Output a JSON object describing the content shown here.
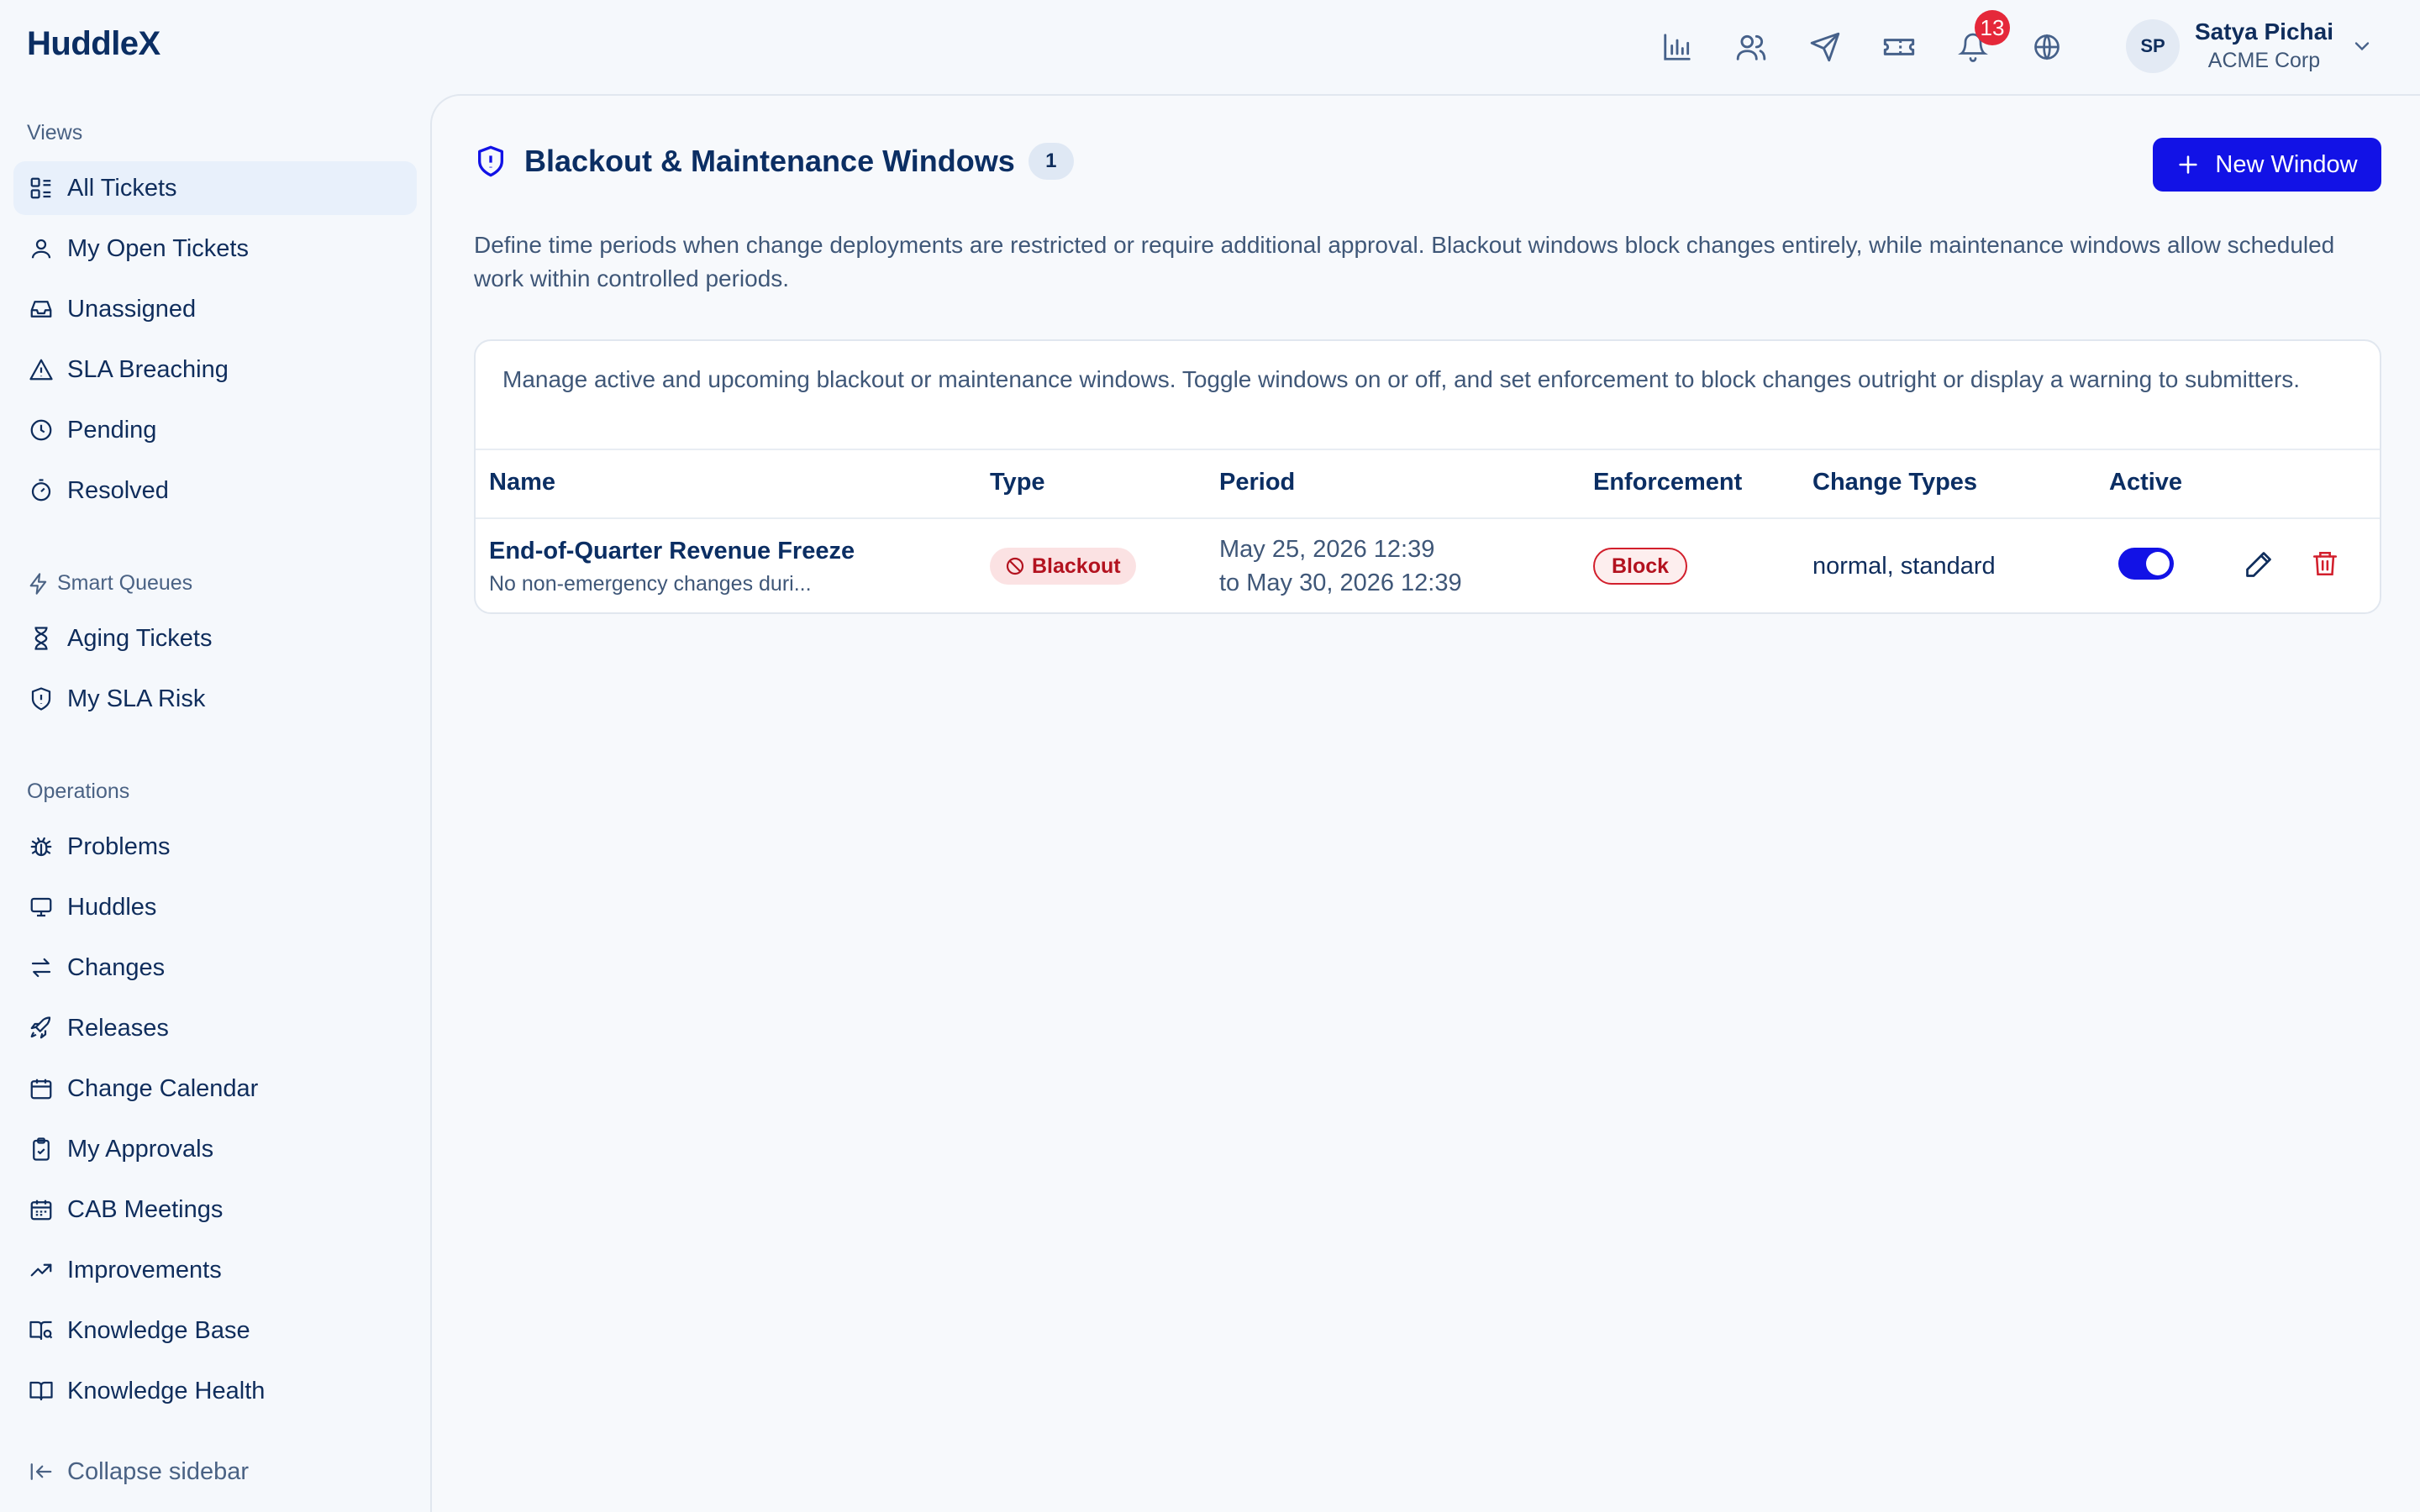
{
  "app": {
    "name": "HuddleX"
  },
  "topbar": {
    "icons": [
      "bar-chart-icon",
      "users-icon",
      "send-icon",
      "ticket-icon",
      "bell-icon",
      "globe-icon"
    ],
    "notification_count": "13",
    "user": {
      "initials": "SP",
      "name": "Satya Pichai",
      "org": "ACME Corp"
    }
  },
  "sidebar": {
    "views_label": "Views",
    "views": [
      {
        "label": "All Tickets",
        "icon": "list-icon",
        "active": true
      },
      {
        "label": "My Open Tickets",
        "icon": "user-icon"
      },
      {
        "label": "Unassigned",
        "icon": "inbox-icon"
      },
      {
        "label": "SLA Breaching",
        "icon": "warning-icon"
      },
      {
        "label": "Pending",
        "icon": "clock-icon"
      },
      {
        "label": "Resolved",
        "icon": "timer-icon"
      }
    ],
    "smart_label": "Smart Queues",
    "smart": [
      {
        "label": "Aging Tickets",
        "icon": "hourglass-icon"
      },
      {
        "label": "My SLA Risk",
        "icon": "shield-alert-icon"
      }
    ],
    "ops_label": "Operations",
    "ops": [
      {
        "label": "Problems",
        "icon": "bug-icon"
      },
      {
        "label": "Huddles",
        "icon": "monitor-icon"
      },
      {
        "label": "Changes",
        "icon": "arrows-icon"
      },
      {
        "label": "Releases",
        "icon": "rocket-icon"
      },
      {
        "label": "Change Calendar",
        "icon": "calendar-icon"
      },
      {
        "label": "My Approvals",
        "icon": "clipboard-check-icon"
      },
      {
        "label": "CAB Meetings",
        "icon": "calendar-grid-icon"
      },
      {
        "label": "Improvements",
        "icon": "trending-up-icon"
      },
      {
        "label": "Knowledge Base",
        "icon": "book-search-icon"
      },
      {
        "label": "Knowledge Health",
        "icon": "book-open-icon"
      }
    ],
    "collapse_label": "Collapse sidebar"
  },
  "page": {
    "title": "Blackout & Maintenance Windows",
    "count": "1",
    "new_button": "New Window",
    "description": "Define time periods when change deployments are restricted or require additional approval. Blackout windows block changes entirely, while maintenance windows allow scheduled work within controlled periods.",
    "card_description": "Manage active and upcoming blackout or maintenance windows. Toggle windows on or off, and set enforcement to block changes outright or display a warning to submitters."
  },
  "table": {
    "columns": [
      "Name",
      "Type",
      "Period",
      "Enforcement",
      "Change Types",
      "Active"
    ],
    "rows": [
      {
        "name": "End-of-Quarter Revenue Freeze",
        "subtitle": "No non-emergency changes duri...",
        "type": "Blackout",
        "period_start": "May 25, 2026 12:39",
        "period_end": "to May 30, 2026 12:39",
        "enforcement": "Block",
        "change_types": "normal, standard",
        "active": true
      }
    ]
  },
  "colors": {
    "primary": "#1212e6",
    "danger": "#d21f2c",
    "text": "#0f2d5c",
    "muted": "#3f5778"
  }
}
